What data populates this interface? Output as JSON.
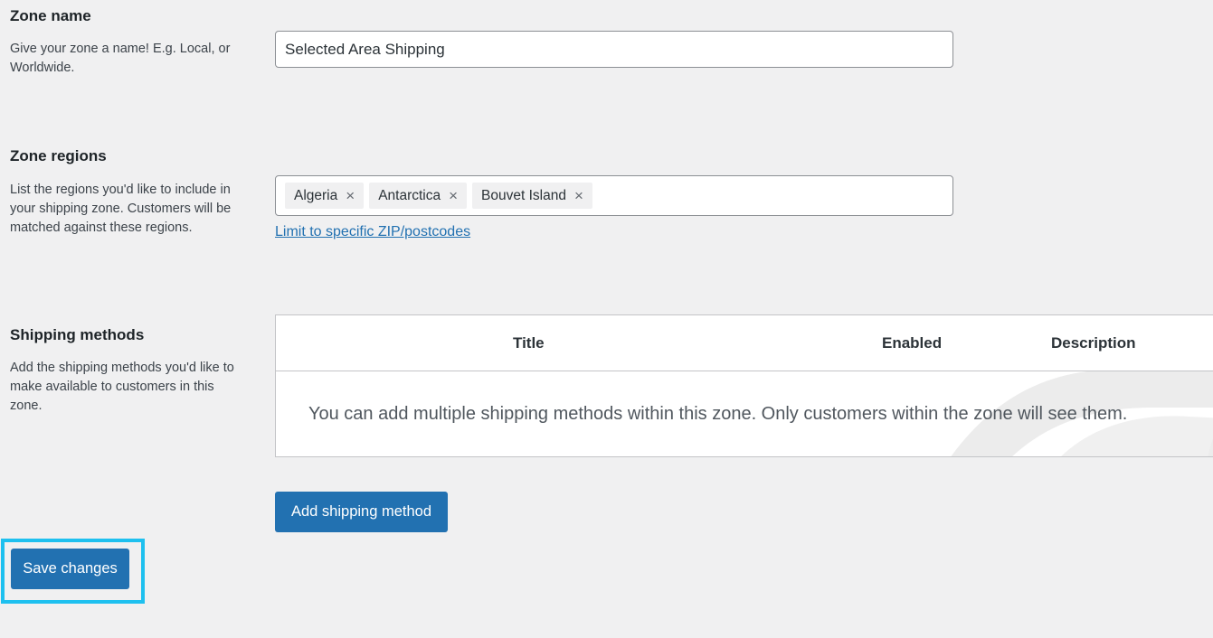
{
  "zone_name": {
    "title": "Zone name",
    "description": "Give your zone a name! E.g. Local, or Worldwide.",
    "value": "Selected Area Shipping"
  },
  "zone_regions": {
    "title": "Zone regions",
    "description": "List the regions you'd like to include in your shipping zone. Customers will be matched against these regions.",
    "regions": [
      {
        "label": "Algeria"
      },
      {
        "label": "Antarctica"
      },
      {
        "label": "Bouvet Island"
      }
    ],
    "remove_glyph": "×",
    "limit_link": "Limit to specific ZIP/postcodes"
  },
  "shipping_methods": {
    "title": "Shipping methods",
    "description": "Add the shipping methods you'd like to make available to customers in this zone.",
    "columns": {
      "title": "Title",
      "enabled": "Enabled",
      "description": "Description"
    },
    "empty_message": "You can add multiple shipping methods within this zone. Only customers within the zone will see them.",
    "add_button": "Add shipping method"
  },
  "actions": {
    "save_button": "Save changes"
  },
  "colors": {
    "background": "#f0f0f1",
    "primary": "#2271b1",
    "highlight": "#1ec0ef"
  }
}
